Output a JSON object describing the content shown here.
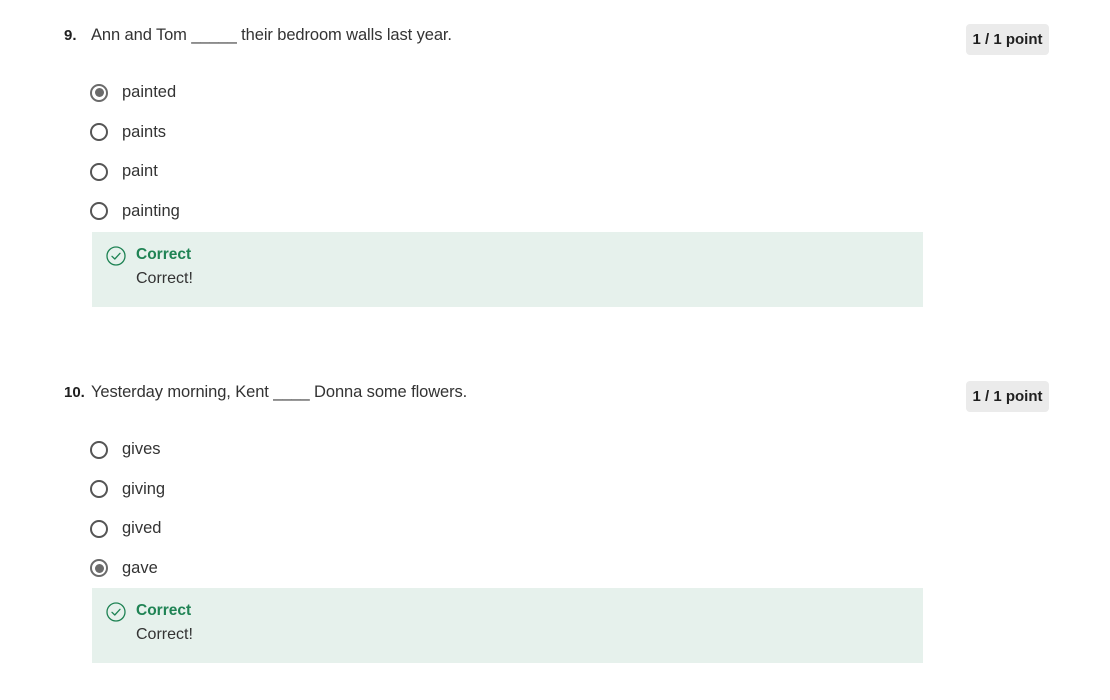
{
  "questions": [
    {
      "number": "9.",
      "text": "Ann and Tom _____ their bedroom walls last year.",
      "points": "1 / 1 point",
      "options": [
        {
          "label": "painted",
          "selected": true
        },
        {
          "label": "paints",
          "selected": false
        },
        {
          "label": "paint",
          "selected": false
        },
        {
          "label": "painting",
          "selected": false
        }
      ],
      "feedback": {
        "icon": "check-circle-icon",
        "title": "Correct",
        "text": "Correct!"
      }
    },
    {
      "number": "10.",
      "text": "Yesterday morning, Kent ____ Donna some flowers.",
      "points": "1 / 1 point",
      "options": [
        {
          "label": "gives",
          "selected": false
        },
        {
          "label": "giving",
          "selected": false
        },
        {
          "label": "gived",
          "selected": false
        },
        {
          "label": "gave",
          "selected": true
        }
      ],
      "feedback": {
        "icon": "check-circle-icon",
        "title": "Correct",
        "text": "Correct!"
      }
    }
  ],
  "colors": {
    "correct_green": "#1f8354",
    "feedback_bg": "#e6f1ec",
    "badge_bg": "#ebebeb"
  }
}
